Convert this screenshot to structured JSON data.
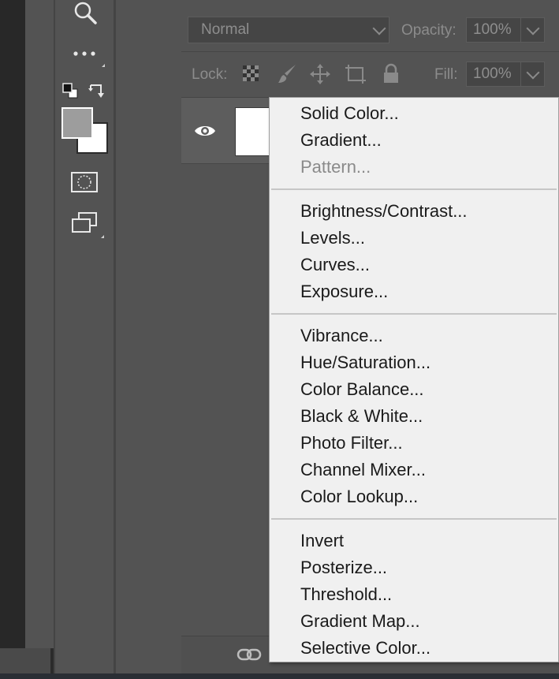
{
  "layers_panel": {
    "blend_mode": "Normal",
    "opacity_label": "Opacity:",
    "opacity_value": "100%",
    "lock_label": "Lock:",
    "fill_label": "Fill:",
    "fill_value": "100%"
  },
  "adjustment_menu": {
    "groups": [
      [
        {
          "label": "Solid Color...",
          "enabled": true
        },
        {
          "label": "Gradient...",
          "enabled": true
        },
        {
          "label": "Pattern...",
          "enabled": false
        }
      ],
      [
        {
          "label": "Brightness/Contrast...",
          "enabled": true
        },
        {
          "label": "Levels...",
          "enabled": true
        },
        {
          "label": "Curves...",
          "enabled": true
        },
        {
          "label": "Exposure...",
          "enabled": true
        }
      ],
      [
        {
          "label": "Vibrance...",
          "enabled": true
        },
        {
          "label": "Hue/Saturation...",
          "enabled": true
        },
        {
          "label": "Color Balance...",
          "enabled": true
        },
        {
          "label": "Black & White...",
          "enabled": true
        },
        {
          "label": "Photo Filter...",
          "enabled": true
        },
        {
          "label": "Channel Mixer...",
          "enabled": true
        },
        {
          "label": "Color Lookup...",
          "enabled": true
        }
      ],
      [
        {
          "label": "Invert",
          "enabled": true
        },
        {
          "label": "Posterize...",
          "enabled": true
        },
        {
          "label": "Threshold...",
          "enabled": true
        },
        {
          "label": "Gradient Map...",
          "enabled": true
        },
        {
          "label": "Selective Color...",
          "enabled": true
        }
      ]
    ]
  },
  "colors": {
    "foreground_swatch": "#9d9d9d",
    "background_swatch": "#ffffff"
  }
}
